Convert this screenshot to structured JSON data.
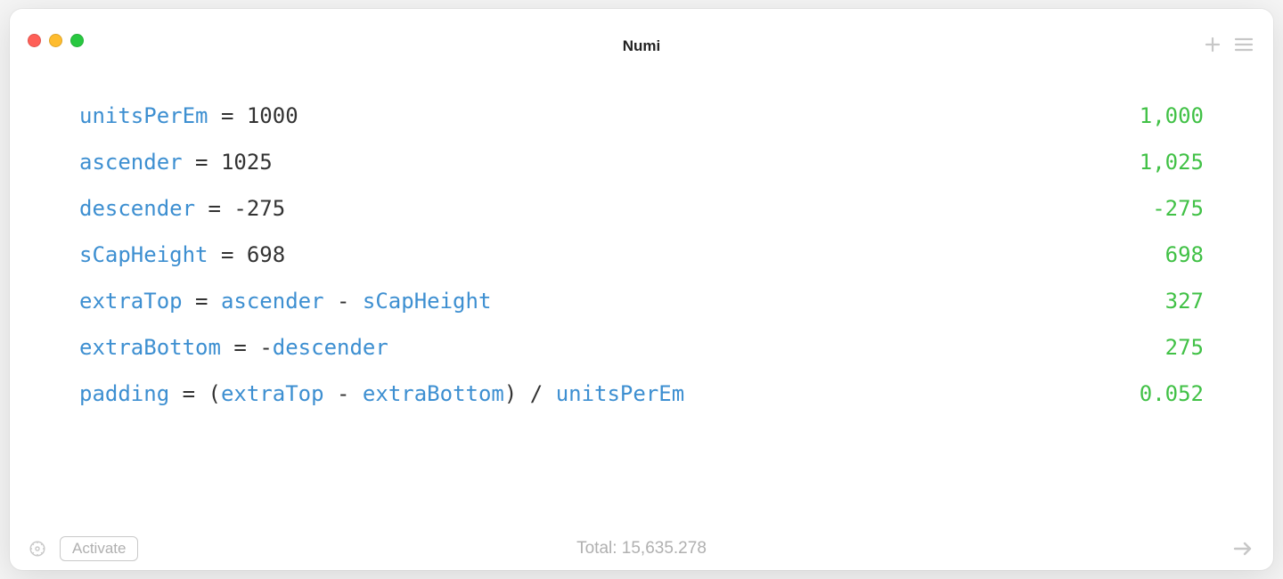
{
  "window": {
    "title": "Numi"
  },
  "lines": [
    {
      "tokens": [
        {
          "t": "var",
          "v": "unitsPerEm"
        },
        {
          "t": "op",
          "v": " = "
        },
        {
          "t": "num",
          "v": "1000"
        }
      ],
      "result": "1,000"
    },
    {
      "tokens": [
        {
          "t": "var",
          "v": "ascender"
        },
        {
          "t": "op",
          "v": " = "
        },
        {
          "t": "num",
          "v": "1025"
        }
      ],
      "result": "1,025"
    },
    {
      "tokens": [
        {
          "t": "var",
          "v": "descender"
        },
        {
          "t": "op",
          "v": " = "
        },
        {
          "t": "op",
          "v": "-"
        },
        {
          "t": "num",
          "v": "275"
        }
      ],
      "result": "-275"
    },
    {
      "tokens": [
        {
          "t": "var",
          "v": "sCapHeight"
        },
        {
          "t": "op",
          "v": " = "
        },
        {
          "t": "num",
          "v": "698"
        }
      ],
      "result": "698"
    },
    {
      "tokens": [
        {
          "t": "var",
          "v": "extraTop"
        },
        {
          "t": "op",
          "v": " = "
        },
        {
          "t": "var",
          "v": "ascender"
        },
        {
          "t": "op",
          "v": " - "
        },
        {
          "t": "var",
          "v": "sCapHeight"
        }
      ],
      "result": "327"
    },
    {
      "tokens": [
        {
          "t": "var",
          "v": "extraBottom"
        },
        {
          "t": "op",
          "v": " = "
        },
        {
          "t": "op",
          "v": "-"
        },
        {
          "t": "var",
          "v": "descender"
        }
      ],
      "result": "275"
    },
    {
      "tokens": [
        {
          "t": "var",
          "v": "padding"
        },
        {
          "t": "op",
          "v": " = "
        },
        {
          "t": "par",
          "v": "("
        },
        {
          "t": "var",
          "v": "extraTop"
        },
        {
          "t": "op",
          "v": " - "
        },
        {
          "t": "var",
          "v": "extraBottom"
        },
        {
          "t": "par",
          "v": ")"
        },
        {
          "t": "op",
          "v": " / "
        },
        {
          "t": "var",
          "v": "unitsPerEm"
        }
      ],
      "result": "0.052"
    }
  ],
  "footer": {
    "activate_label": "Activate",
    "total_label": "Total: 15,635.278"
  }
}
